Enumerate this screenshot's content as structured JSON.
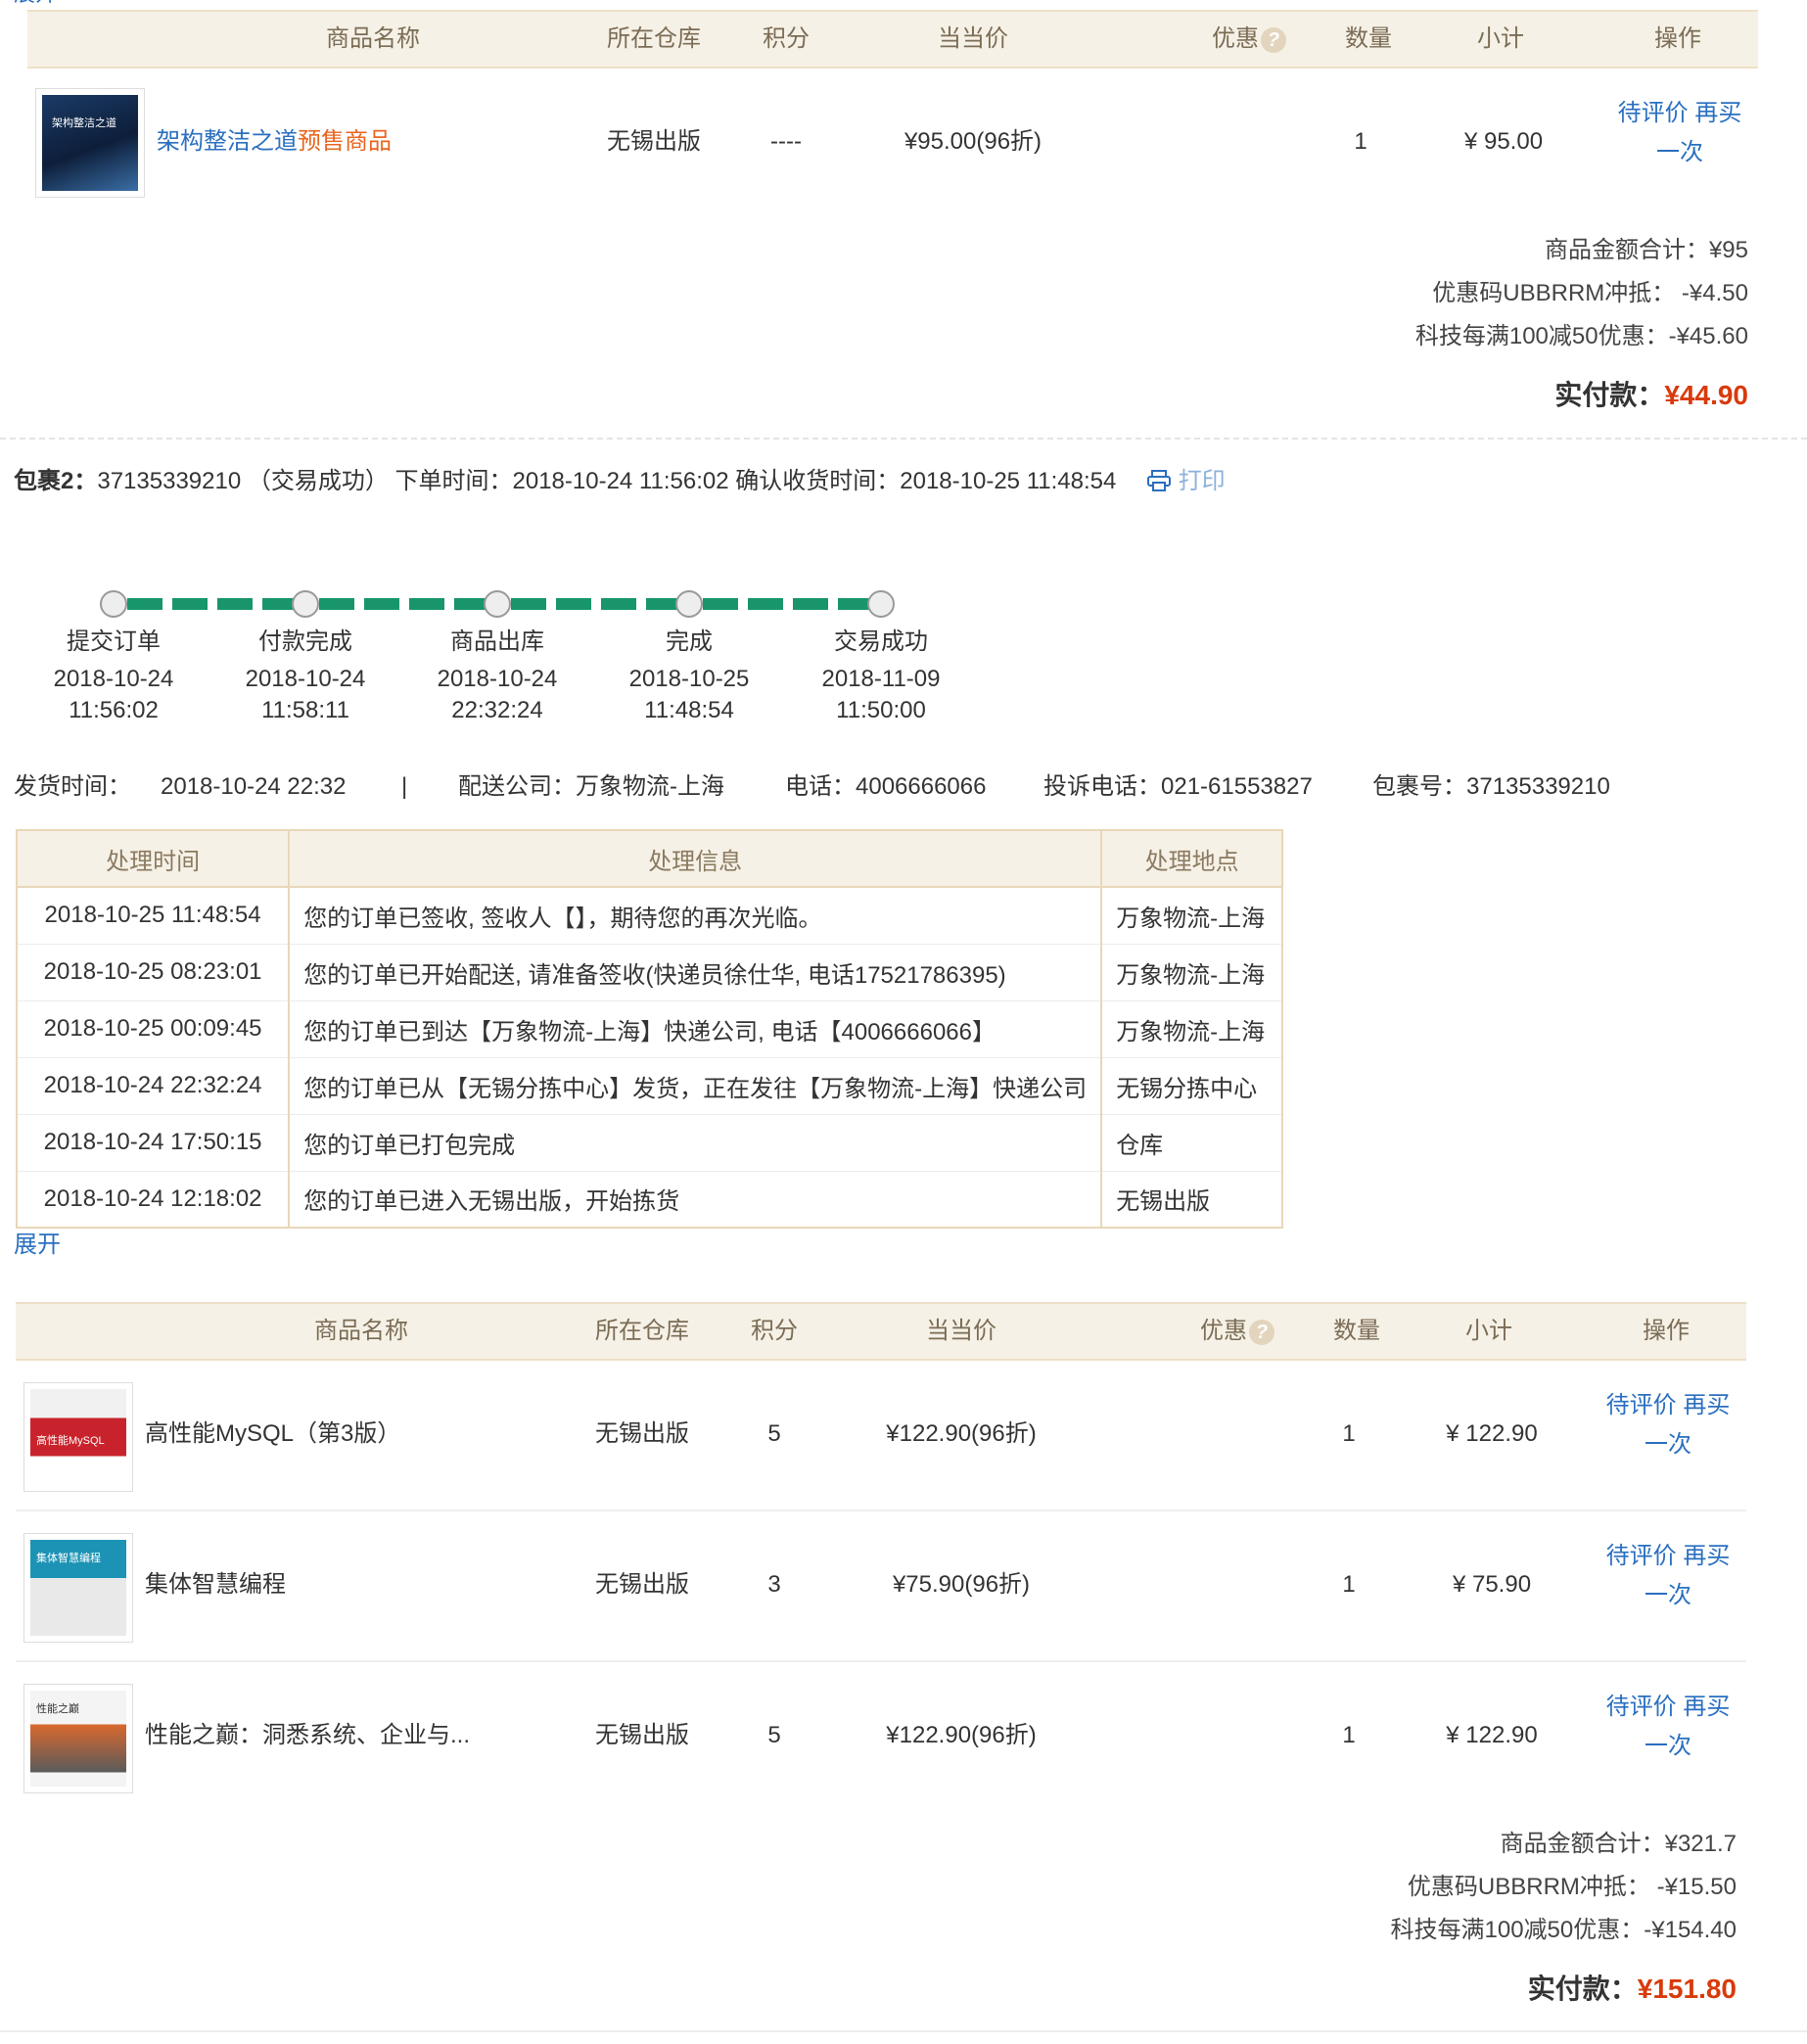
{
  "top_partial_link": "展开",
  "table_headers": [
    "商品名称",
    "所在仓库",
    "积分",
    "当当价",
    "优惠",
    "数量",
    "小计",
    "操作"
  ],
  "help_icon_glyph": "?",
  "package1": {
    "products": [
      {
        "name_main": "架构整洁之道",
        "name_tag": "预售商品",
        "warehouse": "无锡出版",
        "points": "----",
        "price": "¥95.00(96折)",
        "qty": "1",
        "subtotal": "¥ 95.00",
        "op1": "待评价",
        "op2": "再买",
        "op3": "一次",
        "cover_title": "架构整洁之道"
      }
    ],
    "summary": {
      "goods_total": "商品金额合计：¥95",
      "coupon": "优惠码UBBRRM冲抵： -¥4.50",
      "promo": "科技每满100减50优惠：-¥45.60",
      "paid_label": "实付款：",
      "paid_value": "¥44.90"
    }
  },
  "package2": {
    "label": "包裹2：",
    "info": "37135339210 （交易成功） 下单时间：2018-10-24 11:56:02 确认收货时间：2018-10-25 11:48:54",
    "print_label": "打印",
    "steps": [
      {
        "name": "提交订单",
        "date": "2018-10-24",
        "time": "11:56:02"
      },
      {
        "name": "付款完成",
        "date": "2018-10-24",
        "time": "11:58:11"
      },
      {
        "name": "商品出库",
        "date": "2018-10-24",
        "time": "22:32:24"
      },
      {
        "name": "完成",
        "date": "2018-10-25",
        "time": "11:48:54"
      },
      {
        "name": "交易成功",
        "date": "2018-11-09",
        "time": "11:50:00"
      }
    ],
    "ship_time_label": "发货时间：",
    "ship_time": "2018-10-24 22:32",
    "separator": "|",
    "carrier": "配送公司：万象物流-上海",
    "phone": "电话：4006666066",
    "complaint": "投诉电话：021-61553827",
    "package_no": "包裹号：37135339210",
    "log_headers": [
      "处理时间",
      "处理信息",
      "处理地点"
    ],
    "log_rows": [
      {
        "time": "2018-10-25 11:48:54",
        "info": "您的订单已签收, 签收人【】，期待您的再次光临。",
        "place": "万象物流-上海"
      },
      {
        "time": "2018-10-25 08:23:01",
        "info": "您的订单已开始配送, 请准备签收(快递员徐仕华, 电话17521786395)",
        "place": "万象物流-上海"
      },
      {
        "time": "2018-10-25 00:09:45",
        "info": "您的订单已到达【万象物流-上海】快递公司, 电话【4006666066】",
        "place": "万象物流-上海"
      },
      {
        "time": "2018-10-24 22:32:24",
        "info": "您的订单已从【无锡分拣中心】发货，正在发往【万象物流-上海】快递公司",
        "place": "无锡分拣中心"
      },
      {
        "time": "2018-10-24 17:50:15",
        "info": "您的订单已打包完成",
        "place": "仓库"
      },
      {
        "time": "2018-10-24 12:18:02",
        "info": "您的订单已进入无锡出版，开始拣货",
        "place": "无锡出版"
      }
    ],
    "expand": "展开",
    "products": [
      {
        "name": "高性能MySQL（第3版）",
        "warehouse": "无锡出版",
        "points": "5",
        "price": "¥122.90(96折)",
        "qty": "1",
        "subtotal": "¥ 122.90",
        "op1": "待评价",
        "op2": "再买",
        "op3": "一次",
        "cover_title": "高性能MySQL"
      },
      {
        "name": "集体智慧编程",
        "warehouse": "无锡出版",
        "points": "3",
        "price": "¥75.90(96折)",
        "qty": "1",
        "subtotal": "¥ 75.90",
        "op1": "待评价",
        "op2": "再买",
        "op3": "一次",
        "cover_title": "集体智慧编程"
      },
      {
        "name": "性能之巅：洞悉系统、企业与...",
        "warehouse": "无锡出版",
        "points": "5",
        "price": "¥122.90(96折)",
        "qty": "1",
        "subtotal": "¥ 122.90",
        "op1": "待评价",
        "op2": "再买",
        "op3": "一次",
        "cover_title": "性能之巅"
      }
    ],
    "summary": {
      "goods_total": "商品金额合计：¥321.7",
      "coupon": "优惠码UBBRRM冲抵： -¥15.50",
      "promo": "科技每满100减50优惠：-¥154.40",
      "paid_label": "实付款：",
      "paid_value": "¥151.80"
    }
  },
  "colors": {
    "accent_green": "#18956b",
    "link_blue": "#2a6fc0",
    "paid_red": "#d93a0b",
    "header_bg": "#f6f1e6"
  }
}
